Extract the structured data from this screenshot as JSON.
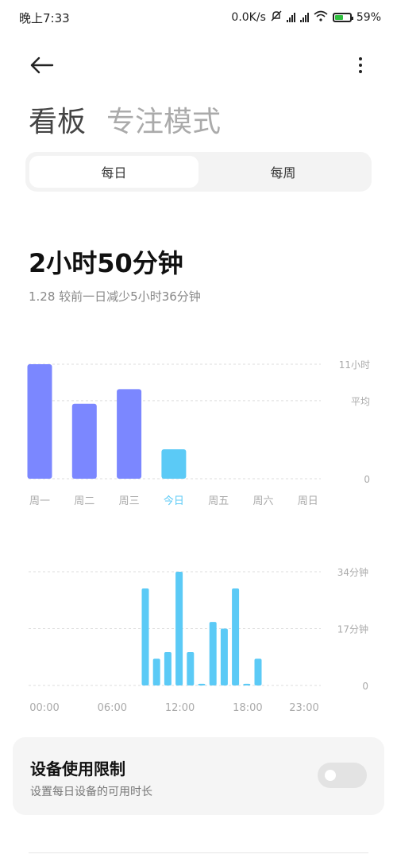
{
  "status_bar": {
    "time": "晚上7:33",
    "net_speed": "0.0K/s",
    "battery_pct": "59%",
    "battery_level": 0.59,
    "battery_color": "#2fbf3f"
  },
  "header": {
    "back_icon": "arrow-left-icon",
    "more_icon": "more-vertical-icon",
    "tab_dashboard": "看板",
    "tab_focus": "专注模式"
  },
  "segmented": {
    "daily": "每日",
    "weekly": "每周",
    "selected": "daily"
  },
  "summary": {
    "total": "2小时50分钟",
    "compare": "1.28  较前一日减少5小时36分钟"
  },
  "colors": {
    "past_bar": "#7b87ff",
    "today_bar": "#5bcaf6",
    "today_label": "#5bcaf6",
    "axis_text": "#aaaaaa",
    "grid": "#dddddd"
  },
  "chart_data": [
    {
      "type": "bar",
      "categories": [
        "周一",
        "周二",
        "周三",
        "今日",
        "周五",
        "周六",
        "周日"
      ],
      "values": [
        11,
        7.2,
        8.6,
        2.83,
        null,
        null,
        null
      ],
      "highlight_index": 3,
      "ylim": [
        0,
        11
      ],
      "y_tick_labels": [
        {
          "value": 11,
          "label": "11小时"
        },
        {
          "value": 7.5,
          "label": "平均"
        },
        {
          "value": 0,
          "label": "0"
        }
      ],
      "grid": true
    },
    {
      "type": "bar",
      "x": [
        0,
        1,
        2,
        3,
        4,
        5,
        6,
        7,
        8,
        9,
        10,
        11,
        12,
        13,
        14,
        15,
        15,
        16,
        17,
        18,
        19,
        20,
        21,
        22,
        23
      ],
      "hours": [
        8,
        9,
        10,
        11,
        12,
        13,
        14,
        15,
        16,
        17,
        18,
        19
      ],
      "values": [
        29,
        8,
        10,
        34,
        10,
        0.5,
        19,
        17,
        29,
        0.3,
        8
      ],
      "value_hours": [
        8.5,
        9,
        9.5,
        10,
        10.5,
        11,
        11.5,
        12,
        12.5,
        13,
        13.5
      ],
      "x_tick_labels": [
        "00:00",
        "06:00",
        "12:00",
        "18:00",
        "23:00"
      ],
      "x_tick_hours": [
        0,
        6,
        12,
        18,
        23
      ],
      "ylim": [
        0,
        34
      ],
      "y_tick_labels": [
        {
          "value": 34,
          "label": "34分钟"
        },
        {
          "value": 17,
          "label": "17分钟"
        },
        {
          "value": 0,
          "label": "0"
        }
      ],
      "grid": true
    }
  ],
  "limit": {
    "title": "设备使用限制",
    "desc": "设置每日设备的可用时长",
    "enabled": false
  }
}
